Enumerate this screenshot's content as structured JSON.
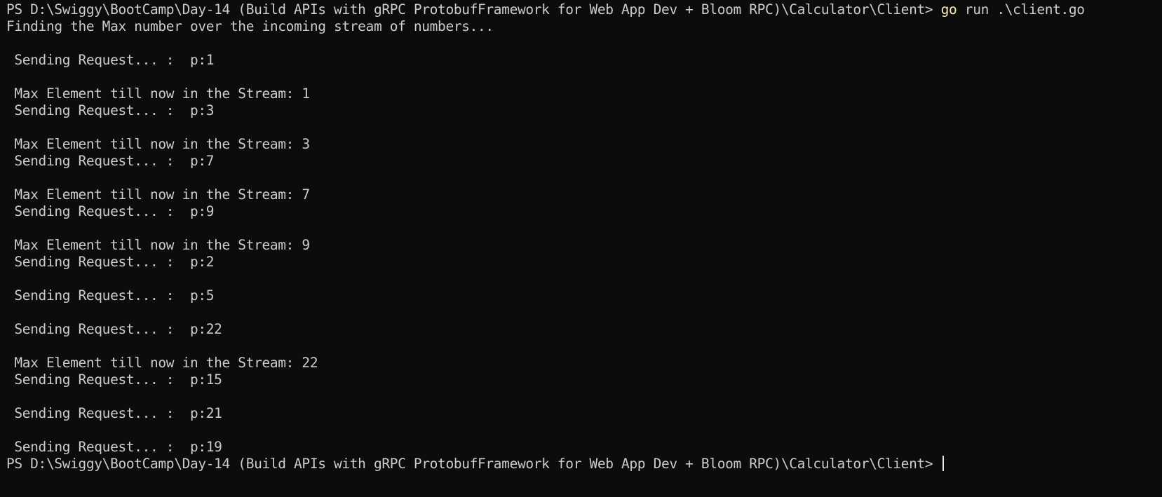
{
  "terminal": {
    "prompt": "PS D:\\Swiggy\\BootCamp\\Day-14 (Build APIs with gRPC ProtobufFramework for Web App Dev + Bloom RPC)\\Calculator\\Client> ",
    "command_keyword": "go",
    "command_args": " run .\\client.go",
    "colors": {
      "background": "#0c0c0c",
      "text": "#cccccc",
      "command_keyword": "#f9f1a5"
    },
    "output_lines": [
      "Finding the Max number over the incoming stream of numbers...",
      "",
      " Sending Request... :  p:1",
      "",
      " Max Element till now in the Stream: 1",
      " Sending Request... :  p:3",
      "",
      " Max Element till now in the Stream: 3",
      " Sending Request... :  p:7",
      "",
      " Max Element till now in the Stream: 7",
      " Sending Request... :  p:9",
      "",
      " Max Element till now in the Stream: 9",
      " Sending Request... :  p:2",
      "",
      " Sending Request... :  p:5",
      "",
      " Sending Request... :  p:22",
      "",
      " Max Element till now in the Stream: 22",
      " Sending Request... :  p:15",
      "",
      " Sending Request... :  p:21",
      "",
      " Sending Request... :  p:19"
    ],
    "final_prompt": "PS D:\\Swiggy\\BootCamp\\Day-14 (Build APIs with gRPC ProtobufFramework for Web App Dev + Bloom RPC)\\Calculator\\Client> "
  }
}
